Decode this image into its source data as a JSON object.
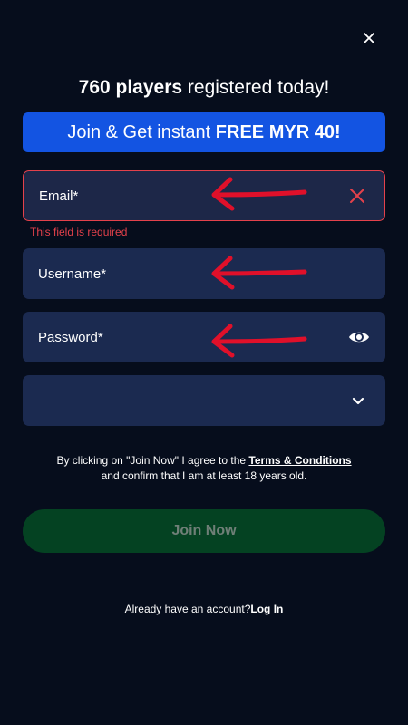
{
  "header": {
    "count": "760 players",
    "text": " registered today!"
  },
  "promo": {
    "prefix": "Join & Get instant ",
    "highlight": "FREE MYR 40!"
  },
  "form": {
    "email": {
      "placeholder": "Email*",
      "error": "This field is required",
      "icon": "clear-x-icon"
    },
    "username": {
      "placeholder": "Username*"
    },
    "password": {
      "placeholder": "Password*",
      "icon": "eye-icon"
    },
    "select": {
      "value": "",
      "icon": "chevron-down-icon"
    }
  },
  "terms": {
    "line1_prefix": "By clicking on \"Join Now\" I agree to the ",
    "link": "Terms & Conditions",
    "line2": "and confirm that I am at least 18 years old."
  },
  "join_button": "Join Now",
  "login": {
    "prompt": "Already have an account?",
    "link": "Log In"
  },
  "colors": {
    "background": "#060d1c",
    "field": "#1b2a50",
    "promo": "#1354e2",
    "error": "#e4414b",
    "join_button": "#044222",
    "annotation_arrow": "#e0102a"
  }
}
